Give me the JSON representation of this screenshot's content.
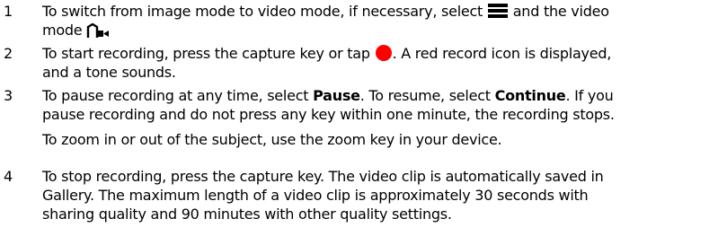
{
  "steps": [
    {
      "number": "1",
      "parts": {
        "a": "To switch from image mode to video mode, if necessary, select",
        "b": "and the video",
        "c": "mode"
      },
      "icons": [
        "menu-icon",
        "video-mode-icon"
      ]
    },
    {
      "number": "2",
      "parts": {
        "a": "To start recording, press the capture key or tap",
        "b": ". A red record icon is displayed,",
        "c": "and a tone sounds."
      },
      "icons": [
        "record-icon"
      ],
      "record_color": "#ff0000"
    },
    {
      "number": "3",
      "parts": {
        "a": "To pause recording at any time, select",
        "pause": "Pause",
        "b": ". To resume, select",
        "continue": "Continue",
        "c": ". If you",
        "d": "pause recording and do not press any key within one minute, the recording stops."
      }
    },
    {
      "note": "To zoom in or out of the subject, use the zoom key in your device."
    },
    {
      "number": "4",
      "lines": [
        "To stop recording, press the capture key. The video clip is automatically saved in",
        "Gallery. The maximum length of a video clip is approximately 30 seconds with",
        "sharing quality and 90 minutes with other quality settings."
      ]
    }
  ]
}
